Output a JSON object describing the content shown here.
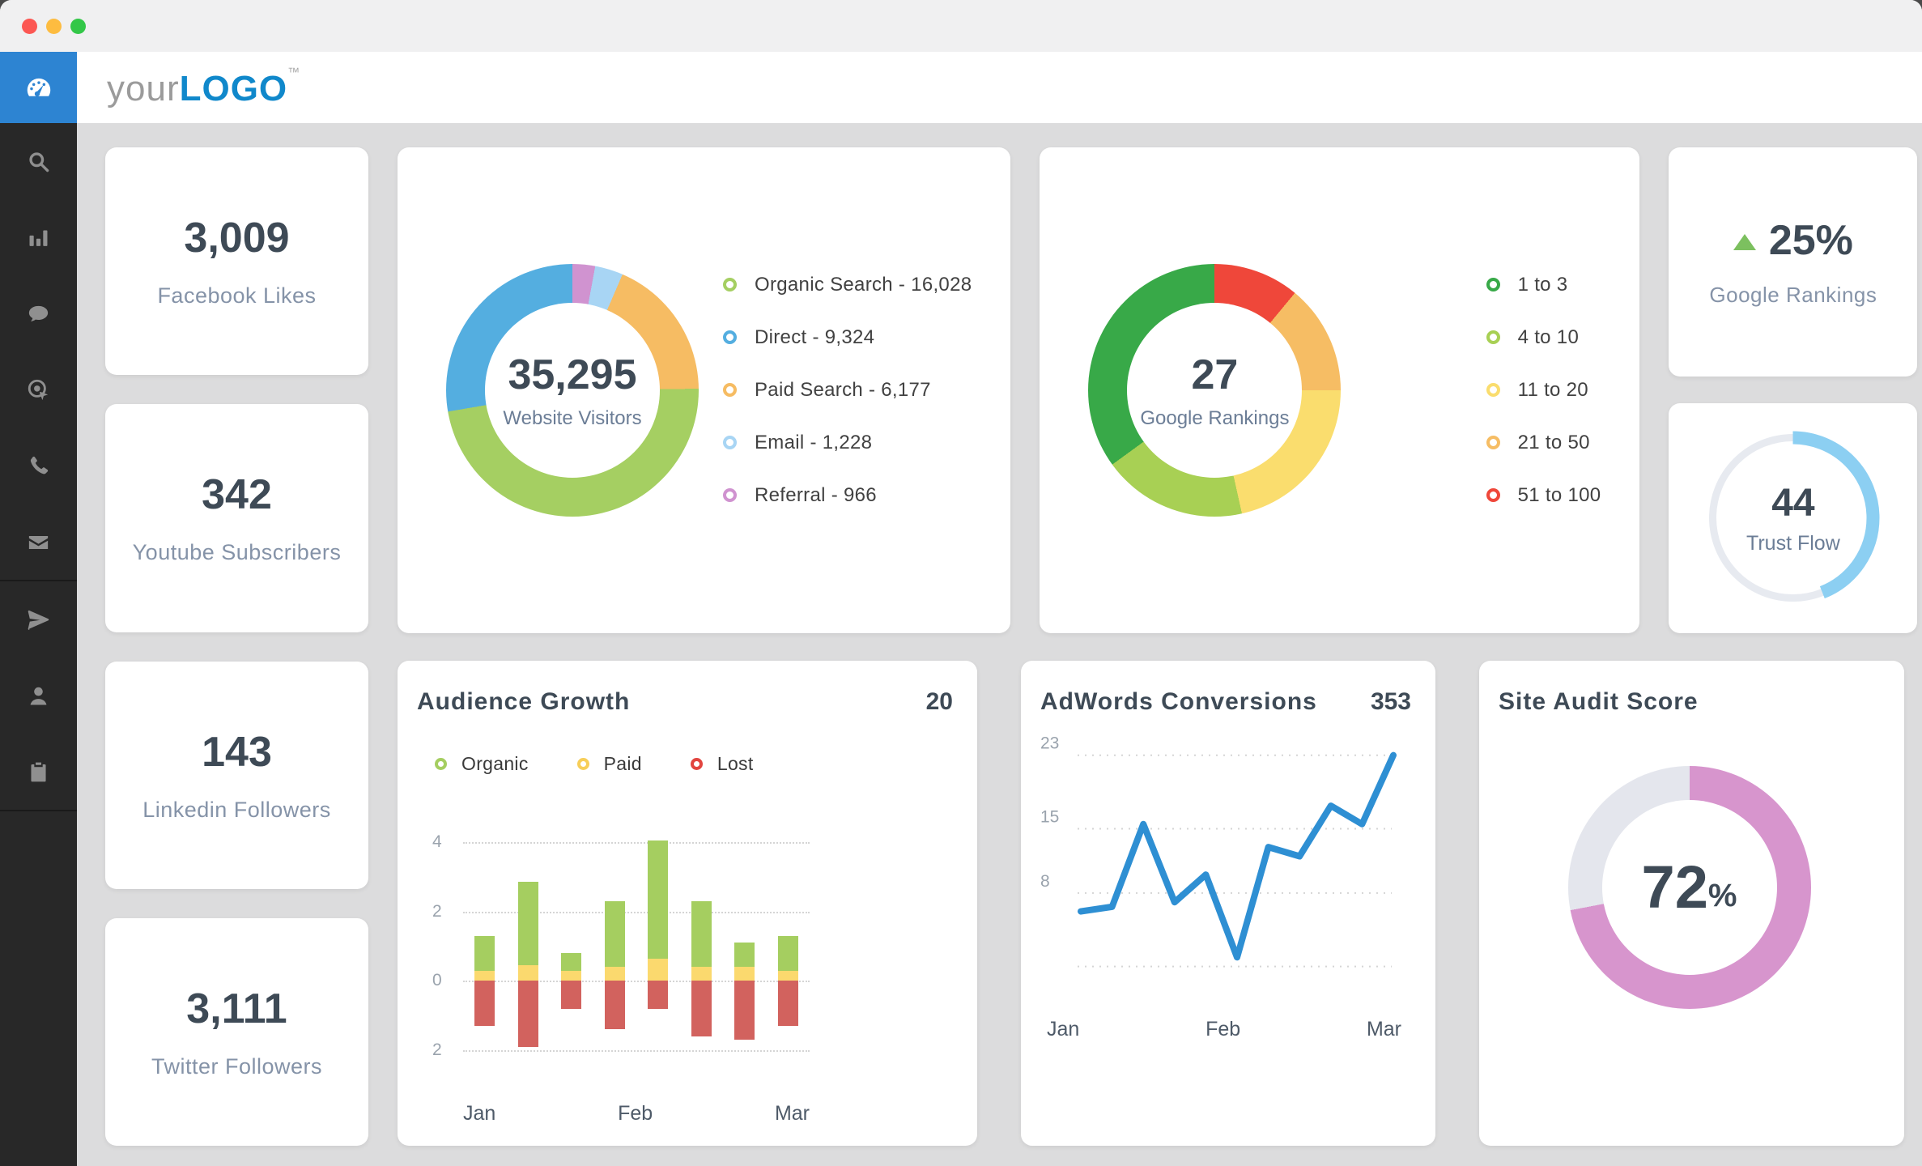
{
  "window": {
    "traffic_lights": [
      {
        "name": "close",
        "color": "#fc5753"
      },
      {
        "name": "minimize",
        "color": "#fdbc40"
      },
      {
        "name": "zoom",
        "color": "#33c748"
      }
    ]
  },
  "header": {
    "logo_prefix": "your",
    "logo_main": "LOGO",
    "logo_tm": "™"
  },
  "sidebar": {
    "active_color": "#2d84d2",
    "items": [
      {
        "icon": "dashboard",
        "active": true
      },
      {
        "icon": "search"
      },
      {
        "icon": "analytics"
      },
      {
        "icon": "chat"
      },
      {
        "icon": "target"
      },
      {
        "icon": "phone"
      },
      {
        "icon": "mail"
      },
      {
        "divider": true
      },
      {
        "icon": "send"
      },
      {
        "icon": "user"
      },
      {
        "icon": "tasks"
      },
      {
        "divider": true
      }
    ]
  },
  "stats": [
    {
      "value": "3,009",
      "label": "Facebook Likes"
    },
    {
      "value": "342",
      "label": "Youtube Subscribers"
    },
    {
      "value": "143",
      "label": "Linkedin Followers"
    },
    {
      "value": "3,111",
      "label": "Twitter Followers"
    }
  ],
  "chart_data": {
    "website_visitors": {
      "type": "pie",
      "center_value": "35,295",
      "center_label": "Website Visitors",
      "legend": [
        {
          "label": "Organic Search",
          "value": "16,028",
          "color": "#a5cf62"
        },
        {
          "label": "Direct",
          "value": "9,324",
          "color": "#54aee0"
        },
        {
          "label": "Paid Search",
          "value": "6,177",
          "color": "#f6bc63"
        },
        {
          "label": "Email",
          "value": "1,228",
          "color": "#a8d5f4"
        },
        {
          "label": "Referral",
          "value": "966",
          "color": "#d093d0"
        }
      ],
      "segments_clockwise_from_top": [
        {
          "label": "Referral",
          "color": "#d093d0",
          "pct": 2.9
        },
        {
          "label": "Email",
          "color": "#a8d5f4",
          "pct": 3.6
        },
        {
          "label": "Paid Search",
          "color": "#f6bc63",
          "pct": 18.3
        },
        {
          "label": "Organic Search",
          "color": "#a5cf62",
          "pct": 47.5
        },
        {
          "label": "Direct",
          "color": "#54aee0",
          "pct": 27.7
        }
      ]
    },
    "google_rankings": {
      "type": "pie",
      "center_value": "27",
      "center_label": "Google Rankings",
      "legend": [
        {
          "label": "1 to 3",
          "color": "#38a948"
        },
        {
          "label": "4 to 10",
          "color": "#a8d054"
        },
        {
          "label": "11 to 20",
          "color": "#fadd6e"
        },
        {
          "label": "21 to 50",
          "color": "#f6bd64"
        },
        {
          "label": "51 to 100",
          "color": "#ef473a"
        }
      ],
      "segments_clockwise_from_top": [
        {
          "label": "51 to 100",
          "color": "#ef473a",
          "pct": 11
        },
        {
          "label": "21 to 50",
          "color": "#f6bd64",
          "pct": 14
        },
        {
          "label": "11 to 20",
          "color": "#fadd6e",
          "pct": 21.5
        },
        {
          "label": "4 to 10",
          "color": "#a8d054",
          "pct": 18.5
        },
        {
          "label": "1 to 3",
          "color": "#38a948",
          "pct": 35
        }
      ]
    },
    "google_rankings_change": {
      "type": "stat",
      "value": "25%",
      "label": "Google Rankings",
      "direction": "up",
      "arrow_color": "#7cc05f"
    },
    "trust_flow": {
      "type": "gauge",
      "value": "44",
      "label": "Trust Flow",
      "pct": 44,
      "color": "#8ccff2",
      "track": "#e7eaf0"
    },
    "audience_growth": {
      "type": "bar",
      "title": "Audience Growth",
      "header_value": "20",
      "legend": [
        {
          "label": "Organic",
          "color": "#a5ce60"
        },
        {
          "label": "Paid",
          "color": "#f7ce58"
        },
        {
          "label": "Lost",
          "color": "#e2453f"
        }
      ],
      "x_axis_labels": [
        "Jan",
        "Feb",
        "Mar"
      ],
      "y_ticks": [
        {
          "v": 4,
          "t": "4"
        },
        {
          "v": 2,
          "t": "2"
        },
        {
          "v": 0,
          "t": "0"
        },
        {
          "v": -2,
          "t": "2"
        }
      ],
      "ylim": [
        -2.45,
        4.45
      ],
      "series": [
        {
          "name": "Organic",
          "color": "#a5ce60",
          "values": [
            1.0,
            2.4,
            0.5,
            1.9,
            3.4,
            1.9,
            0.7,
            1.0
          ]
        },
        {
          "name": "Paid",
          "color": "#fbd96e",
          "values": [
            0.3,
            0.45,
            0.3,
            0.4,
            0.65,
            0.4,
            0.4,
            0.3
          ]
        },
        {
          "name": "Lost",
          "color": "#d2625e",
          "values": [
            -1.3,
            -1.9,
            -0.8,
            -1.4,
            -0.8,
            -1.6,
            -1.7,
            -1.3
          ]
        }
      ]
    },
    "adwords_conversions": {
      "type": "line",
      "title": "AdWords Conversions",
      "header_value": "353",
      "color": "#2e8fd3",
      "x_axis_labels": [
        "Jan",
        "Feb",
        "Mar"
      ],
      "y_ticks": [
        {
          "v": 23,
          "t": "23"
        },
        {
          "v": 15,
          "t": "15"
        },
        {
          "v": 8,
          "t": "8"
        },
        {
          "v": 0,
          "t": ""
        }
      ],
      "ylim": [
        -2.5,
        25
      ],
      "values": [
        6,
        6.5,
        15.5,
        7,
        10,
        1,
        13,
        12,
        17.5,
        15.5,
        23
      ]
    },
    "site_audit": {
      "type": "gauge",
      "title": "Site Audit Score",
      "value": "72",
      "unit": "%",
      "pct": 72,
      "color": "#d795cd",
      "track": "#e4e6ed"
    }
  }
}
